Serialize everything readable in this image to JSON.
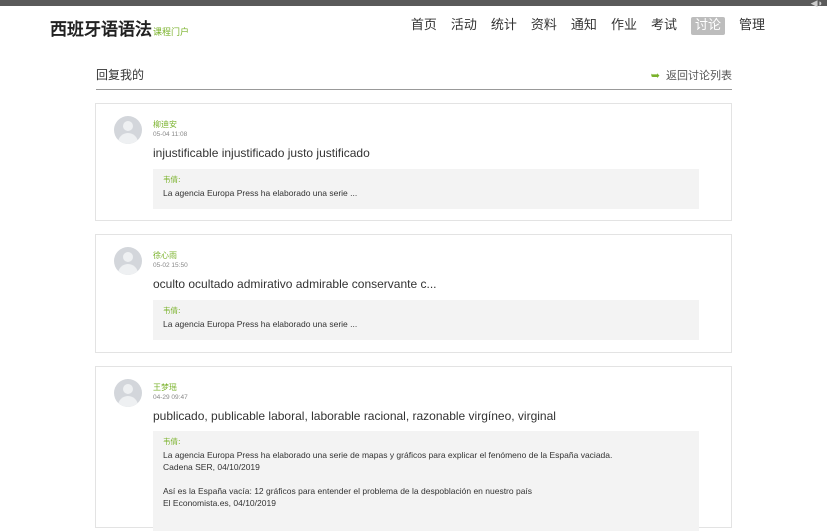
{
  "header": {
    "brand": "西班牙语语法",
    "brand_sub": "课程门户",
    "nav": [
      {
        "label": "首页",
        "active": false
      },
      {
        "label": "活动",
        "active": false
      },
      {
        "label": "统计",
        "active": false
      },
      {
        "label": "资料",
        "active": false
      },
      {
        "label": "通知",
        "active": false
      },
      {
        "label": "作业",
        "active": false
      },
      {
        "label": "考试",
        "active": false
      },
      {
        "label": "讨论",
        "active": true
      },
      {
        "label": "管理",
        "active": false
      }
    ]
  },
  "page": {
    "title": "回复我的",
    "back_label": "返回讨论列表"
  },
  "replies": [
    {
      "user": "柳迪安",
      "time": "05-04 11:08",
      "content": "injustificable injustificado justo justificado",
      "quote_name": "韦倩:",
      "quote_lines": [
        "La agencia Europa Press ha elaborado una serie ..."
      ]
    },
    {
      "user": "徐心雨",
      "time": "05-02 15:50",
      "content": "oculto ocultado admirativo admirable conservante c...",
      "quote_name": "韦倩:",
      "quote_lines": [
        "La agencia Europa Press ha elaborado una serie ..."
      ]
    },
    {
      "user": "王梦瑶",
      "time": "04-29 09:47",
      "content": "publicado, publicable laboral, laborable racional, razonable virgíneo, virginal",
      "quote_name": "韦倩:",
      "quote_lines": [
        "La agencia Europa Press ha elaborado una serie de mapas y gráficos para explicar el fenómeno de la España vaciada.",
        "Cadena SER, 04/10/2019",
        "",
        "Así es la España vacía: 12 gráficos para entender el problema de la despoblación en nuestro país",
        "El Economista.es, 04/10/2019"
      ]
    }
  ]
}
